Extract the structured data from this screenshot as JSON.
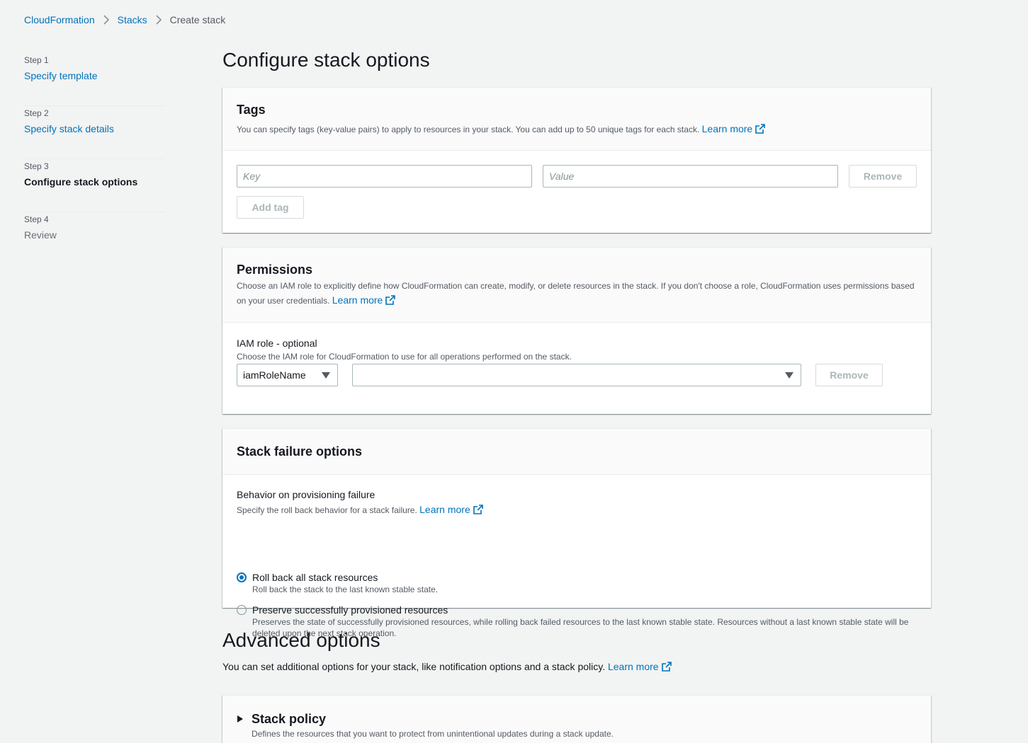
{
  "breadcrumb": {
    "items": [
      "CloudFormation",
      "Stacks"
    ],
    "current": "Create stack"
  },
  "steps": [
    {
      "num": "Step 1",
      "label": "Specify template"
    },
    {
      "num": "Step 2",
      "label": "Specify stack details"
    },
    {
      "num": "Step 3",
      "label": "Configure stack options"
    },
    {
      "num": "Step 4",
      "label": "Review"
    }
  ],
  "page_title": "Configure stack options",
  "tags": {
    "title": "Tags",
    "desc": "You can specify tags (key-value pairs) to apply to resources in your stack. You can add up to 50 unique tags for each stack.",
    "learn_more": "Learn more",
    "key_placeholder": "Key",
    "value_placeholder": "Value",
    "remove_label": "Remove",
    "add_tag_label": "Add tag"
  },
  "permissions": {
    "title": "Permissions",
    "desc": "Choose an IAM role to explicitly define how CloudFormation can create, modify, or delete resources in the stack. If you don't choose a role, CloudFormation uses permissions based on your user credentials.",
    "learn_more": "Learn more",
    "iam_label": "IAM role - optional",
    "iam_desc": "Choose the IAM role for CloudFormation to use for all operations performed on the stack.",
    "role_type_value": "iamRoleName",
    "role_value": "",
    "remove_label": "Remove"
  },
  "failure": {
    "title": "Stack failure options",
    "behavior_label": "Behavior on provisioning failure",
    "behavior_desc": "Specify the roll back behavior for a stack failure.",
    "learn_more": "Learn more",
    "options": [
      {
        "label": "Roll back all stack resources",
        "desc": "Roll back the stack to the last known stable state.",
        "selected": true
      },
      {
        "label": "Preserve successfully provisioned resources",
        "desc": "Preserves the state of successfully provisioned resources, while rolling back failed resources to the last known stable state. Resources without a last known stable state will be deleted upon the next stack operation.",
        "selected": false
      }
    ]
  },
  "advanced": {
    "title": "Advanced options",
    "desc": "You can set additional options for your stack, like notification options and a stack policy.",
    "learn_more": "Learn more",
    "stack_policy_title": "Stack policy",
    "stack_policy_desc": "Defines the resources that you want to protect from unintentional updates during a stack update."
  },
  "colors": {
    "link": "#0073bb",
    "background": "#f2f3f3",
    "panel_header": "#fafafa"
  }
}
